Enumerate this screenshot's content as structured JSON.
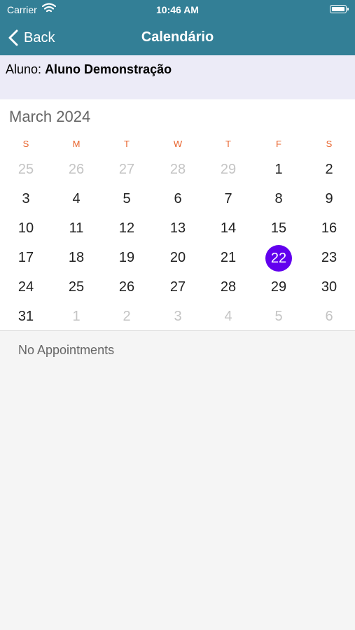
{
  "status_bar": {
    "carrier": "Carrier",
    "time": "10:46 AM"
  },
  "nav": {
    "back_label": "Back",
    "title": "Calendário"
  },
  "student": {
    "prefix": "Aluno:",
    "name": "Aluno Demonstração"
  },
  "calendar": {
    "month_title": "March 2024",
    "weekdays": [
      "S",
      "M",
      "T",
      "W",
      "T",
      "F",
      "S"
    ],
    "weeks": [
      [
        {
          "d": "25",
          "other": true
        },
        {
          "d": "26",
          "other": true
        },
        {
          "d": "27",
          "other": true
        },
        {
          "d": "28",
          "other": true
        },
        {
          "d": "29",
          "other": true
        },
        {
          "d": "1"
        },
        {
          "d": "2"
        }
      ],
      [
        {
          "d": "3"
        },
        {
          "d": "4"
        },
        {
          "d": "5"
        },
        {
          "d": "6"
        },
        {
          "d": "7"
        },
        {
          "d": "8"
        },
        {
          "d": "9"
        }
      ],
      [
        {
          "d": "10"
        },
        {
          "d": "11"
        },
        {
          "d": "12"
        },
        {
          "d": "13"
        },
        {
          "d": "14"
        },
        {
          "d": "15"
        },
        {
          "d": "16"
        }
      ],
      [
        {
          "d": "17"
        },
        {
          "d": "18"
        },
        {
          "d": "19"
        },
        {
          "d": "20"
        },
        {
          "d": "21"
        },
        {
          "d": "22",
          "selected": true
        },
        {
          "d": "23"
        }
      ],
      [
        {
          "d": "24"
        },
        {
          "d": "25"
        },
        {
          "d": "26"
        },
        {
          "d": "27"
        },
        {
          "d": "28"
        },
        {
          "d": "29"
        },
        {
          "d": "30"
        }
      ],
      [
        {
          "d": "31"
        },
        {
          "d": "1",
          "other": true
        },
        {
          "d": "2",
          "other": true
        },
        {
          "d": "3",
          "other": true
        },
        {
          "d": "4",
          "other": true
        },
        {
          "d": "5",
          "other": true
        },
        {
          "d": "6",
          "other": true
        }
      ]
    ],
    "selected_color": "#6200ee",
    "weekday_color": "#e8622a"
  },
  "appointments": {
    "empty_text": "No Appointments"
  },
  "colors": {
    "nav_bg": "#337f96",
    "student_bar_bg": "#ecebf7"
  },
  "icons": {
    "back": "chevron-left-icon",
    "wifi": "wifi-icon",
    "battery": "battery-icon"
  }
}
